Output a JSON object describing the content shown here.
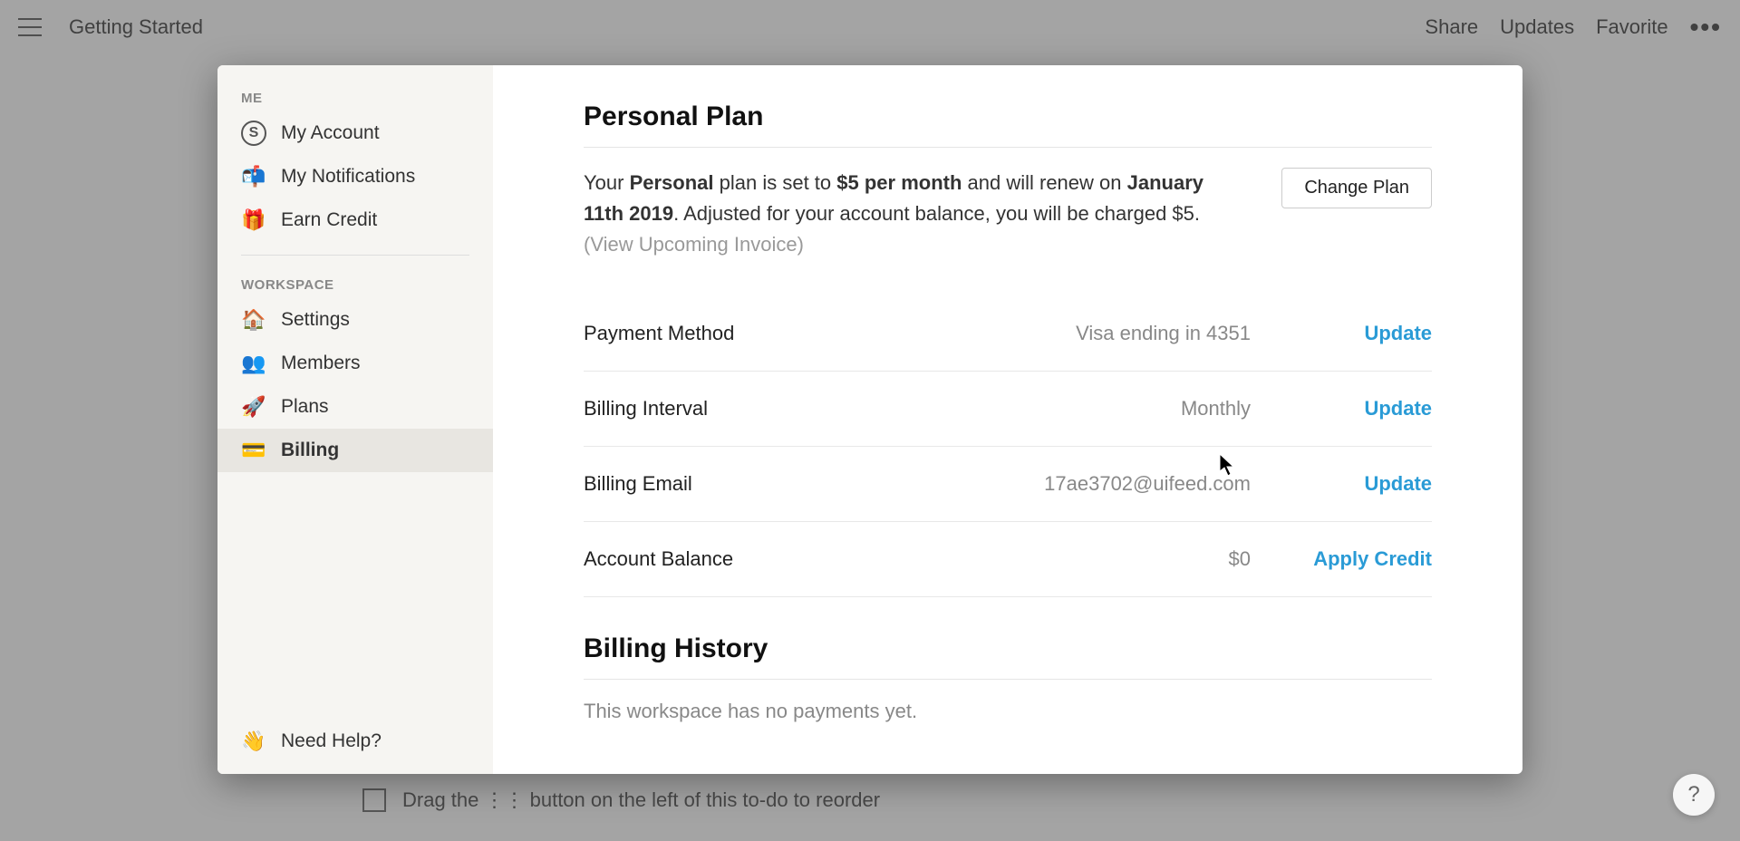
{
  "topbar": {
    "title": "Getting Started",
    "actions": {
      "share": "Share",
      "updates": "Updates",
      "favorite": "Favorite"
    }
  },
  "page_bg": {
    "todo_text": "Drag the ⋮⋮ button on the left of this to-do to reorder"
  },
  "help_fab": "?",
  "sidebar": {
    "me_header": "ME",
    "workspace_header": "WORKSPACE",
    "me_items": [
      {
        "icon": "S",
        "label": "My Account"
      },
      {
        "icon": "📬",
        "label": "My Notifications"
      },
      {
        "icon": "🎁",
        "label": "Earn Credit"
      }
    ],
    "workspace_items": [
      {
        "icon": "🏠",
        "label": "Settings"
      },
      {
        "icon": "👥",
        "label": "Members"
      },
      {
        "icon": "🚀",
        "label": "Plans"
      },
      {
        "icon": "💳",
        "label": "Billing"
      }
    ],
    "help": {
      "icon": "👋",
      "label": "Need Help?"
    }
  },
  "main": {
    "heading": "Personal Plan",
    "plan_desc": {
      "prefix": "Your ",
      "plan_name": "Personal",
      "mid1": " plan is set to ",
      "price": "$5 per month",
      "mid2": " and will renew on ",
      "renew_date": "January 11th 2019",
      "suffix": ". Adjusted for your account balance, you will be charged $5. ",
      "view_invoice": "(View Upcoming Invoice)"
    },
    "change_plan": "Change Plan",
    "rows": [
      {
        "label": "Payment Method",
        "value": "Visa ending in 4351",
        "action": "Update"
      },
      {
        "label": "Billing Interval",
        "value": "Monthly",
        "action": "Update"
      },
      {
        "label": "Billing Email",
        "value": "17ae3702@uifeed.com",
        "action": "Update"
      },
      {
        "label": "Account Balance",
        "value": "$0",
        "action": "Apply Credit"
      }
    ],
    "history_heading": "Billing History",
    "history_empty": "This workspace has no payments yet."
  }
}
